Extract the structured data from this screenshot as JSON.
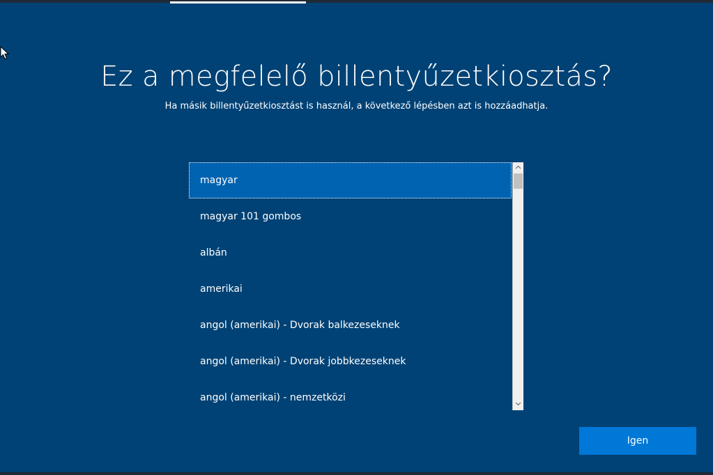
{
  "page": {
    "title": "Ez a megfelelő billentyűzetkiosztás?",
    "subtitle": "Ha másik billentyűzetkiosztást is használ, a következő lépésben azt is hozzáadhatja."
  },
  "layout_list": {
    "selected_index": 0,
    "items": [
      "magyar",
      "magyar 101 gombos",
      "albán",
      "amerikai",
      "angol (amerikai) - Dvorak balkezeseknek",
      "angol (amerikai) - Dvorak jobbkezeseknek",
      "angol (amerikai) - nemzetközi"
    ]
  },
  "scrollbar": {
    "up_icon": "chevron-up-icon",
    "down_icon": "chevron-down-icon"
  },
  "actions": {
    "yes_label": "Igen"
  },
  "colors": {
    "background": "#004275",
    "selected": "#0063b1",
    "button": "#0078d7"
  }
}
